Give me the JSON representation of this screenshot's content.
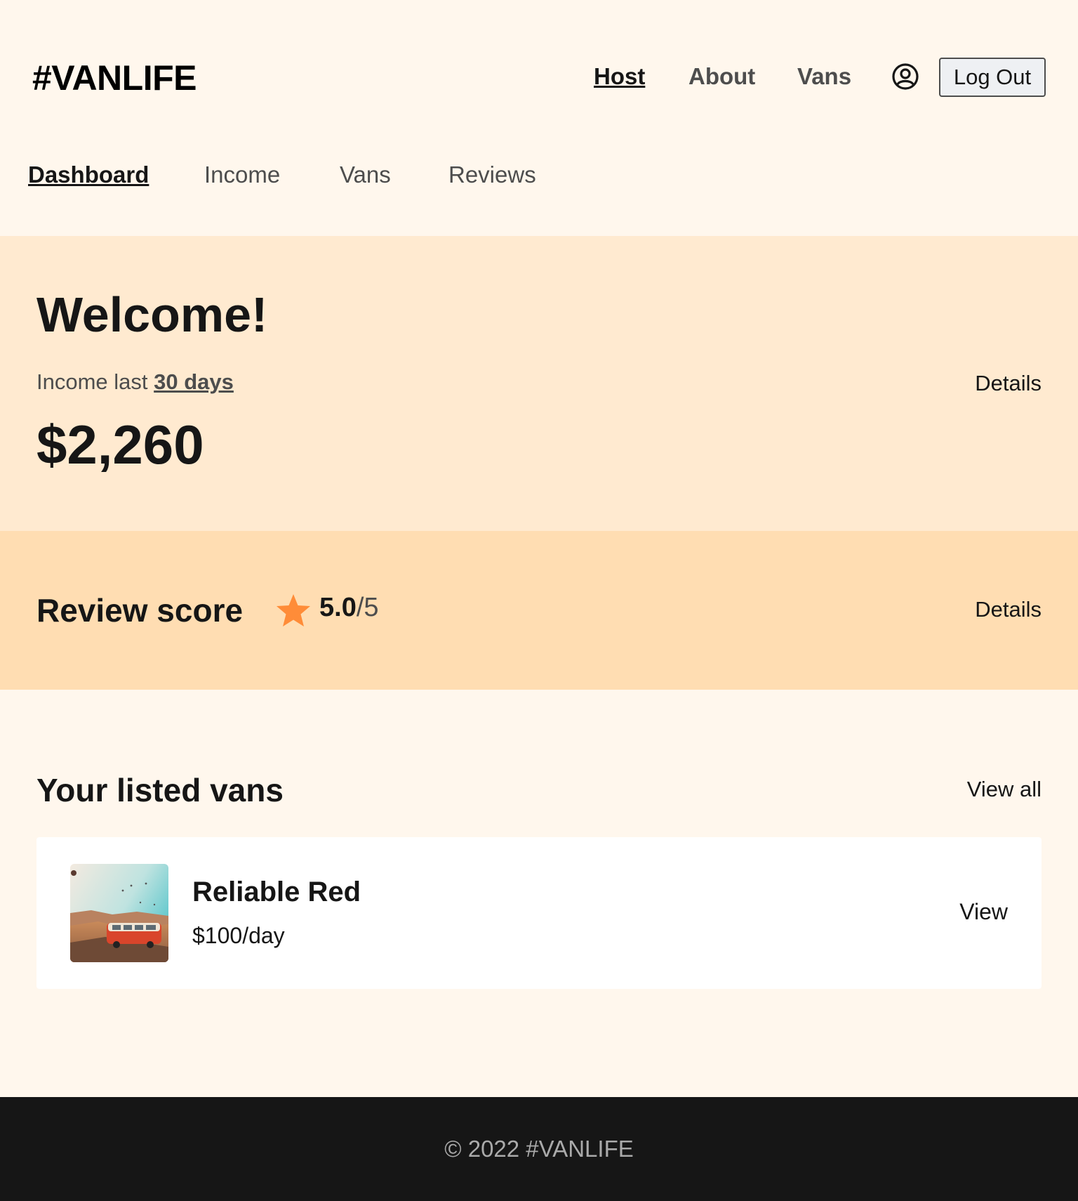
{
  "header": {
    "logo": "#VANLIFE",
    "nav": [
      {
        "label": "Host",
        "active": true
      },
      {
        "label": "About",
        "active": false
      },
      {
        "label": "Vans",
        "active": false
      }
    ],
    "user_icon": "user-circle-icon",
    "logout_label": "Log Out"
  },
  "host_nav": [
    {
      "label": "Dashboard",
      "active": true
    },
    {
      "label": "Income",
      "active": false
    },
    {
      "label": "Vans",
      "active": false
    },
    {
      "label": "Reviews",
      "active": false
    }
  ],
  "welcome": {
    "title": "Welcome!",
    "income_prefix": "Income last",
    "income_period": "30 days",
    "income_amount": "$2,260",
    "details_label": "Details"
  },
  "review": {
    "title": "Review score",
    "star_icon": "star-icon",
    "score": "5.0",
    "score_max": "/5",
    "details_label": "Details"
  },
  "listed_vans": {
    "title": "Your listed vans",
    "view_all_label": "View all",
    "items": [
      {
        "name": "Reliable Red",
        "price": "$100/day",
        "view_label": "View"
      }
    ]
  },
  "footer": {
    "text": "© 2022 #VANLIFE"
  },
  "colors": {
    "page_bg": "#FFF7ED",
    "welcome_bg": "#FFEAD0",
    "review_bg": "#FFDDB2",
    "star": "#FF8C38",
    "footer_bg": "#161616"
  }
}
